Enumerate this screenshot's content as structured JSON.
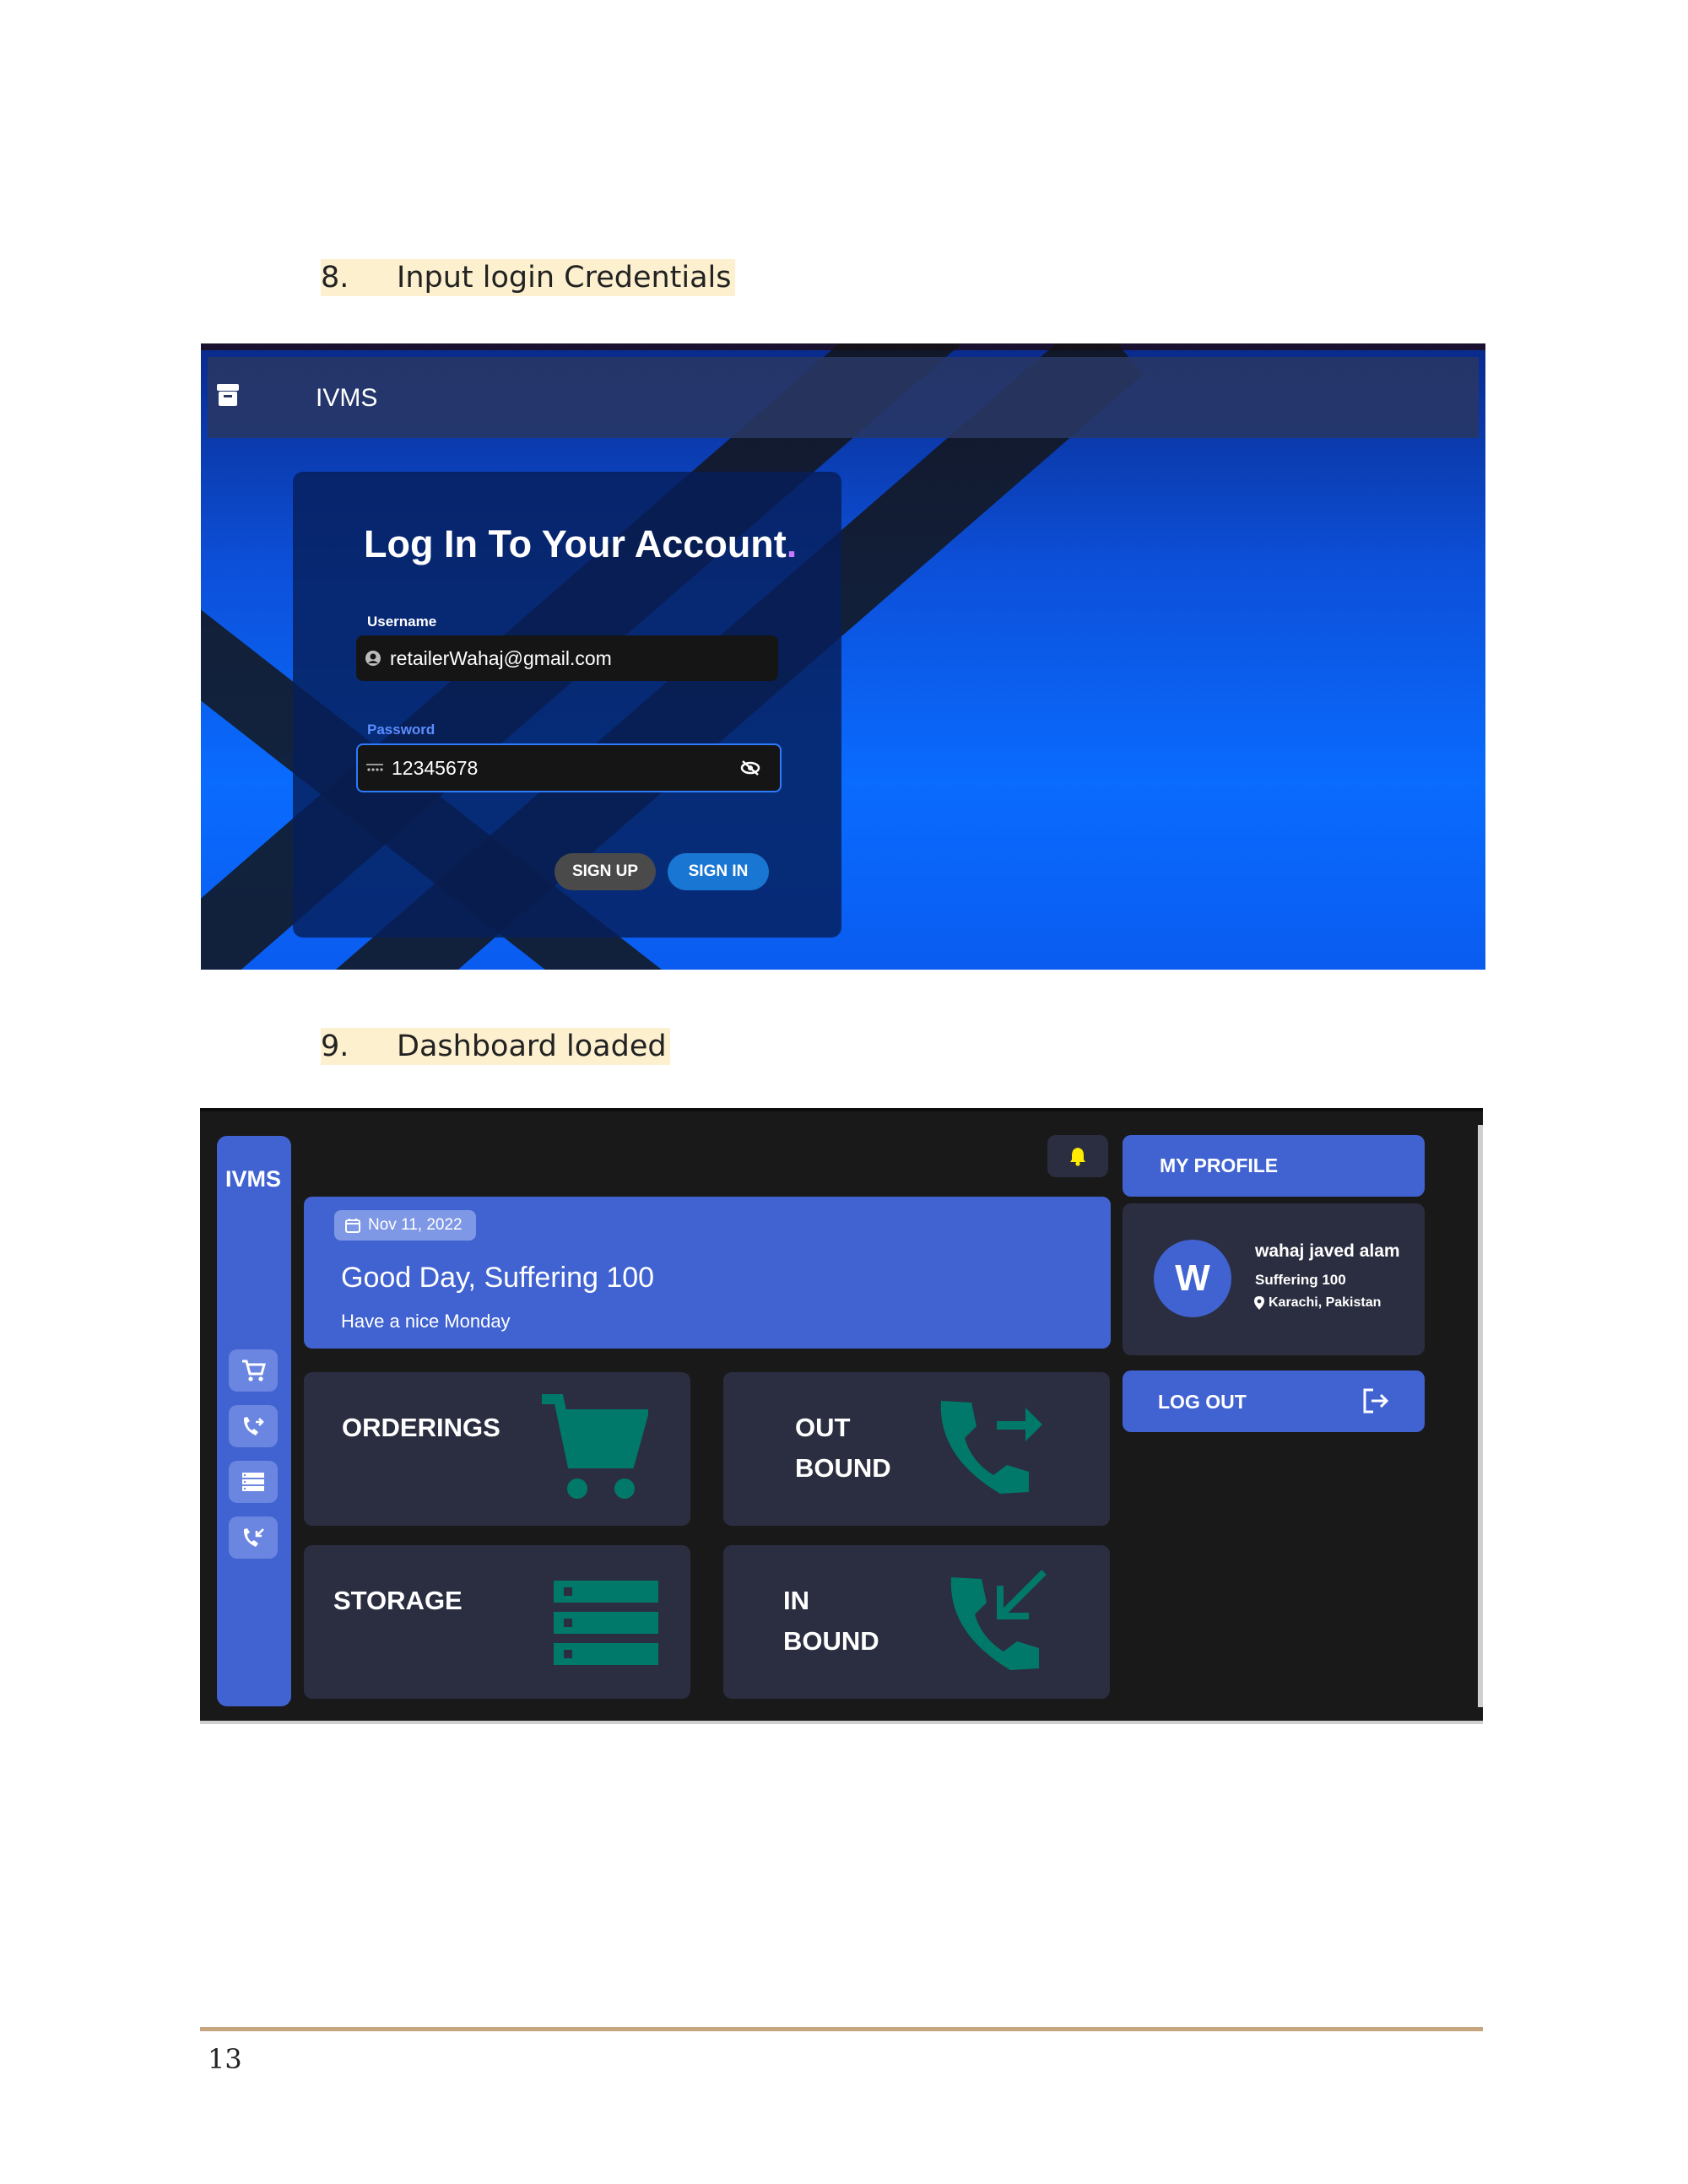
{
  "captions": [
    {
      "number": "8.",
      "text": "Input login Credentials"
    },
    {
      "number": "9.",
      "text": "Dashboard loaded"
    }
  ],
  "login": {
    "app_title": "IVMS",
    "heading": "Log In To Your Account",
    "heading_dot": ".",
    "username_label": "Username",
    "username_value": "retailerWahaj@gmail.com",
    "password_label": "Password",
    "password_value": "12345678",
    "signup_label": "SIGN UP",
    "signin_label": "SIGN IN",
    "colors": {
      "accent": "#1976d2",
      "label_username": "#ffffff",
      "label_password": "#5b8dff"
    }
  },
  "dashboard": {
    "sidebar_title": "IVMS",
    "sidebar_icons": [
      "cart-icon",
      "outbound-call-icon",
      "list-icon",
      "inbound-call-icon"
    ],
    "banner": {
      "date": "Nov 11, 2022",
      "greeting": "Good Day, Suffering 100",
      "subtext": "Have a nice Monday"
    },
    "tiles": {
      "orderings": "ORDERINGS",
      "outbound_line1": "OUT",
      "outbound_line2": "BOUND",
      "storage": "STORAGE",
      "inbound_line1": "IN",
      "inbound_line2": "BOUND"
    },
    "profile": {
      "header": "MY PROFILE",
      "avatar_letter": "W",
      "name": "wahaj javed alam",
      "role": "Suffering 100",
      "location": "Karachi, Pakistan"
    },
    "logout_label": "LOG OUT",
    "colors": {
      "primary": "#4163d2",
      "tile": "#2b2e40",
      "icon_teal": "#00796b",
      "bell": "#ffeb00",
      "background": "#191919"
    }
  },
  "footer": {
    "page_number": "13"
  }
}
